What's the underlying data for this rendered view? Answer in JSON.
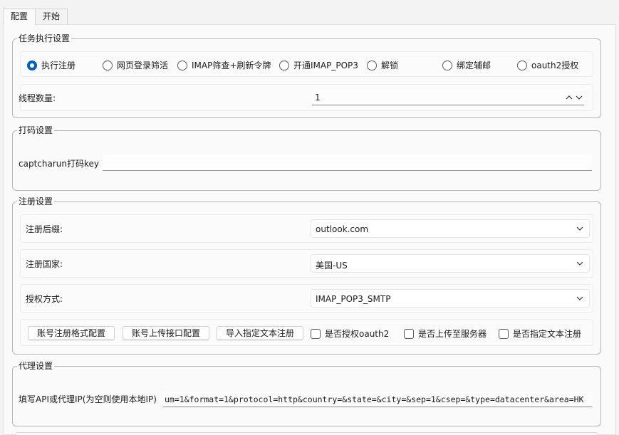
{
  "tabs": [
    {
      "label": "配置",
      "active": true
    },
    {
      "label": "开始",
      "active": false
    }
  ],
  "task_group": {
    "title": "任务执行设置",
    "modes": [
      {
        "label": "执行注册",
        "checked": true
      },
      {
        "label": "网页登录筛活",
        "checked": false
      },
      {
        "label": "IMAP筛查+刷新令牌",
        "checked": false
      },
      {
        "label": "开通IMAP_POP3",
        "checked": false
      },
      {
        "label": "解锁",
        "checked": false
      },
      {
        "label": "绑定辅邮",
        "checked": false
      },
      {
        "label": "oauth2授权",
        "checked": false
      }
    ],
    "threads_label": "线程数量:",
    "threads_value": "1"
  },
  "captcha_group": {
    "title": "打码设置",
    "key_label": "captcharun打码key",
    "key_value": ""
  },
  "register_group": {
    "title": "注册设置",
    "suffix_label": "注册后缀:",
    "suffix_value": "outlook.com",
    "country_label": "注册国家:",
    "country_value": "美国-US",
    "auth_label": "授权方式:",
    "auth_value": "IMAP_POP3_SMTP",
    "buttons": {
      "format_config": "账号注册格式配置",
      "upload_config": "账号上传接口配置",
      "import_text": "导入指定文本注册"
    },
    "checks": {
      "oauth2": "是否授权oauth2",
      "upload_server": "是否上传至服务器",
      "text_register": "是否指定文本注册"
    }
  },
  "proxy_group": {
    "title": "代理设置",
    "label": "填写API或代理IP(为空则使用本地IP)",
    "value": "um=1&format=1&protocol=http&country=&state=&city=&sep=1&csep=&type=datacenter&area=HK"
  },
  "colors": {
    "accent": "#005fb8",
    "border": "#b6b6b6"
  }
}
